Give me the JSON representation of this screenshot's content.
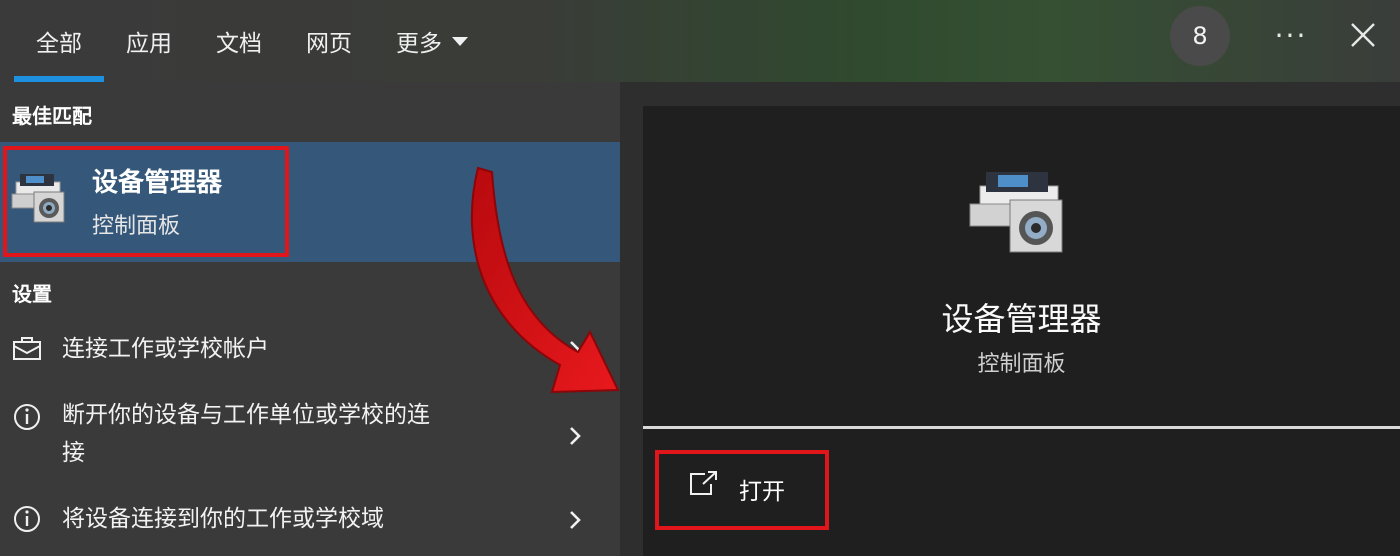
{
  "tabs": [
    {
      "label": "全部",
      "active": true
    },
    {
      "label": "应用",
      "active": false
    },
    {
      "label": "文档",
      "active": false
    },
    {
      "label": "网页",
      "active": false
    },
    {
      "label": "更多",
      "active": false
    }
  ],
  "header": {
    "count": "8",
    "more_glyph": "···"
  },
  "best_match": {
    "heading": "最佳匹配",
    "title": "设备管理器",
    "subtitle": "控制面板",
    "icon": "device-manager-icon"
  },
  "settings": {
    "heading": "设置",
    "items": [
      {
        "line1": "连接工作或学校帐户",
        "line2": "",
        "icon": "briefcase-icon"
      },
      {
        "line1": "断开你的设备与工作单位或学校的连",
        "line2": "接",
        "icon": "info-icon"
      },
      {
        "line1": "将设备连接到你的工作或学校域",
        "line2": "",
        "icon": "info-icon"
      }
    ]
  },
  "detail": {
    "title": "设备管理器",
    "subtitle": "控制面板",
    "action_label": "打开"
  },
  "colors": {
    "accent": "#1e90e0",
    "highlight_red": "#e0161a",
    "selected_row": "#34577a"
  }
}
